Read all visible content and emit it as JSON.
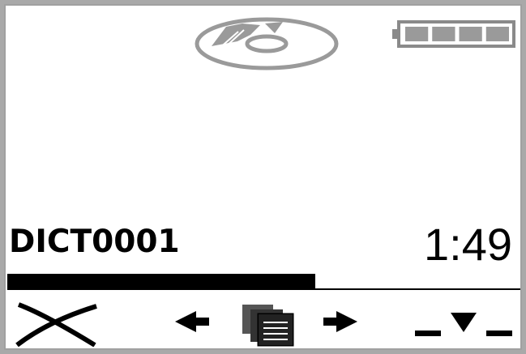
{
  "status": {
    "disc_icon": "disc-icon",
    "battery_icon": "battery-full-icon",
    "battery_level": 1.0
  },
  "recording": {
    "filename": "DICT0001",
    "time": "1:49",
    "progress": 0.6
  },
  "softkeys": {
    "left": "close-icon",
    "prev": "arrow-left-icon",
    "center": "documents-icon",
    "next": "arrow-right-icon",
    "right": "down-marker-icon"
  },
  "colors": {
    "foreground": "#000000",
    "background": "#ffffff",
    "icon_gray": "#9a9a9a"
  }
}
